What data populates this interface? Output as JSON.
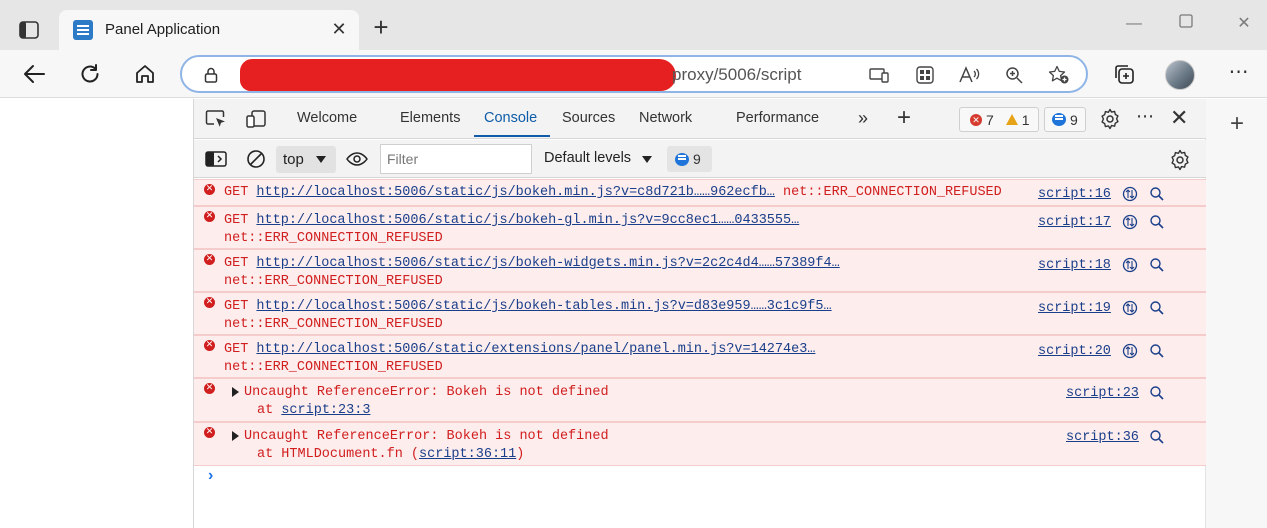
{
  "browser": {
    "tab": {
      "title": "Panel Application"
    },
    "address": {
      "visible_url": "proxy/5006/script"
    }
  },
  "devtools": {
    "tabs": [
      {
        "label": "Welcome"
      },
      {
        "label": "Elements"
      },
      {
        "label": "Console",
        "active": true
      },
      {
        "label": "Sources"
      },
      {
        "label": "Network"
      },
      {
        "label": "Performance"
      }
    ],
    "issues": {
      "errors": "7",
      "warnings": "1",
      "messages": "9"
    },
    "console_toolbar": {
      "context": "top",
      "filter_placeholder": "Filter",
      "levels": "Default levels",
      "message_count": "9"
    },
    "logs": [
      {
        "method": "GET",
        "url": "http://localhost:5006/static/js/bokeh.min.js?v=c8d721b……962ecfb…",
        "error": "net::ERR_CONNECTION_REFUSED",
        "source": "script:16"
      },
      {
        "method": "GET",
        "url": "http://localhost:5006/static/js/bokeh-gl.min.js?v=9cc8ec1……0433555…",
        "error": "net::ERR_CONNECTION_REFUSED",
        "source": "script:17"
      },
      {
        "method": "GET",
        "url": "http://localhost:5006/static/js/bokeh-widgets.min.js?v=2c2c4d4……57389f4…",
        "error": "net::ERR_CONNECTION_REFUSED",
        "source": "script:18"
      },
      {
        "method": "GET",
        "url": "http://localhost:5006/static/js/bokeh-tables.min.js?v=d83e959……3c1c9f5…",
        "error": "net::ERR_CONNECTION_REFUSED",
        "source": "script:19"
      },
      {
        "method": "GET",
        "url": "http://localhost:5006/static/extensions/panel/panel.min.js?v=14274e3…",
        "error": "net::ERR_CONNECTION_REFUSED",
        "source": "script:20"
      }
    ],
    "exceptions": [
      {
        "message": "Uncaught ReferenceError: Bokeh is not defined",
        "at_prefix": "at",
        "at_link": "script:23:3",
        "source": "script:23"
      },
      {
        "message": "Uncaught ReferenceError: Bokeh is not defined",
        "at_prefix": "at HTMLDocument.fn (",
        "at_link": "script:36:11",
        "at_suffix": ")",
        "source": "script:36"
      }
    ],
    "prompt": "›"
  },
  "colors": {
    "accent": "#0f5da8",
    "error_text": "#d11e1e",
    "error_bg": "#fdeded",
    "redaction": "#e62020"
  }
}
